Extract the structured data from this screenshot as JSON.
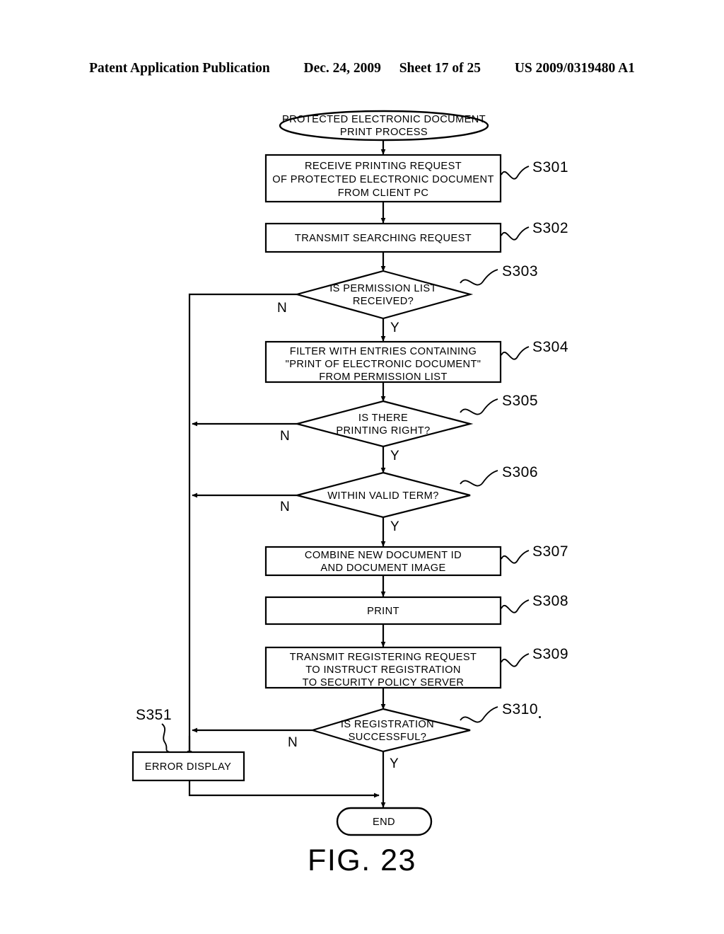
{
  "header": {
    "publication": "Patent Application Publication",
    "date": "Dec. 24, 2009",
    "sheet": "Sheet 17 of 25",
    "patent_number": "US 2009/0319480 A1"
  },
  "figure": {
    "caption": "FIG. 23",
    "type": "flowchart"
  },
  "flowchart": {
    "start": {
      "label": "PROTECTED ELECTRONIC DOCUMENT\nPRINT PROCESS",
      "lines": [
        "PROTECTED ELECTRONIC DOCUMENT",
        "PRINT PROCESS"
      ],
      "shape": "ellipse"
    },
    "end": {
      "label": "END",
      "lines": [
        "END"
      ],
      "shape": "stadium"
    },
    "steps": [
      {
        "ref": "S301",
        "shape": "process",
        "lines": [
          "RECEIVE PRINTING REQUEST",
          "OF PROTECTED ELECTRONIC DOCUMENT",
          "FROM CLIENT PC"
        ]
      },
      {
        "ref": "S302",
        "shape": "process",
        "lines": [
          "TRANSMIT SEARCHING REQUEST"
        ]
      },
      {
        "ref": "S303",
        "shape": "decision",
        "lines": [
          "IS PERMISSION LIST",
          "RECEIVED?"
        ],
        "yes_label": "Y",
        "no_label": "N"
      },
      {
        "ref": "S304",
        "shape": "process",
        "lines": [
          "FILTER WITH ENTRIES CONTAINING",
          "\"PRINT OF ELECTRONIC DOCUMENT\"",
          "FROM PERMISSION LIST"
        ]
      },
      {
        "ref": "S305",
        "shape": "decision",
        "lines": [
          "IS THERE",
          "PRINTING RIGHT?"
        ],
        "yes_label": "Y",
        "no_label": "N"
      },
      {
        "ref": "S306",
        "shape": "decision",
        "lines": [
          "WITHIN VALID TERM?"
        ],
        "yes_label": "Y",
        "no_label": "N"
      },
      {
        "ref": "S307",
        "shape": "process",
        "lines": [
          "COMBINE NEW DOCUMENT ID",
          "AND DOCUMENT IMAGE"
        ]
      },
      {
        "ref": "S308",
        "shape": "process",
        "lines": [
          "PRINT"
        ]
      },
      {
        "ref": "S309",
        "shape": "process",
        "lines": [
          "TRANSMIT REGISTERING REQUEST",
          "TO INSTRUCT REGISTRATION",
          "TO SECURITY POLICY SERVER"
        ]
      },
      {
        "ref": "S310",
        "shape": "decision",
        "lines": [
          "IS REGISTRATION",
          "SUCCESSFUL?"
        ],
        "yes_label": "Y",
        "no_label": "N"
      },
      {
        "ref": "S351",
        "shape": "process",
        "lines": [
          "ERROR DISPLAY"
        ]
      }
    ]
  }
}
